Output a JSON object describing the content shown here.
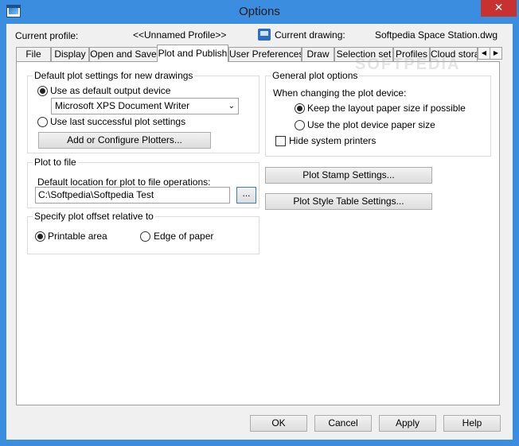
{
  "window": {
    "title": "Options",
    "close_glyph": "✕"
  },
  "header": {
    "profile_label": "Current profile:",
    "profile_value": "<<Unnamed Profile>>",
    "drawing_label": "Current drawing:",
    "drawing_value": "Softpedia Space Station.dwg"
  },
  "tabs": [
    {
      "label": "File"
    },
    {
      "label": "Display"
    },
    {
      "label": "Open and Save"
    },
    {
      "label": "Plot and Publish",
      "active": true
    },
    {
      "label": "User Preferences"
    },
    {
      "label": "Draw"
    },
    {
      "label": "Selection set"
    },
    {
      "label": "Profiles"
    },
    {
      "label": "Cloud stora"
    }
  ],
  "tab_scroll": {
    "left": "◀",
    "right": "▶"
  },
  "watermark": "SOFTPEDIA",
  "default_plot": {
    "title": "Default plot settings for new drawings",
    "use_default_label": "Use as default output device",
    "device_selected": "Microsoft XPS Document Writer",
    "use_last_label": "Use last successful plot settings",
    "configure_button": "Add or Configure Plotters..."
  },
  "plot_to_file": {
    "title": "Plot to file",
    "location_label": "Default location for plot to file operations:",
    "location_value": "C:\\Softpedia\\Softpedia Test",
    "browse_button": "..."
  },
  "plot_offset": {
    "title": "Specify plot offset relative to",
    "printable_label": "Printable area",
    "edge_label": "Edge of paper"
  },
  "general": {
    "title": "General plot options",
    "when_label": "When changing the plot device:",
    "keep_label": "Keep the layout paper size if possible",
    "use_device_label": "Use the plot device paper size",
    "hide_label": "Hide system printers"
  },
  "buttons": {
    "plot_stamp": "Plot Stamp Settings...",
    "plot_style": "Plot Style Table Settings...",
    "ok": "OK",
    "cancel": "Cancel",
    "apply": "Apply",
    "help": "Help"
  }
}
